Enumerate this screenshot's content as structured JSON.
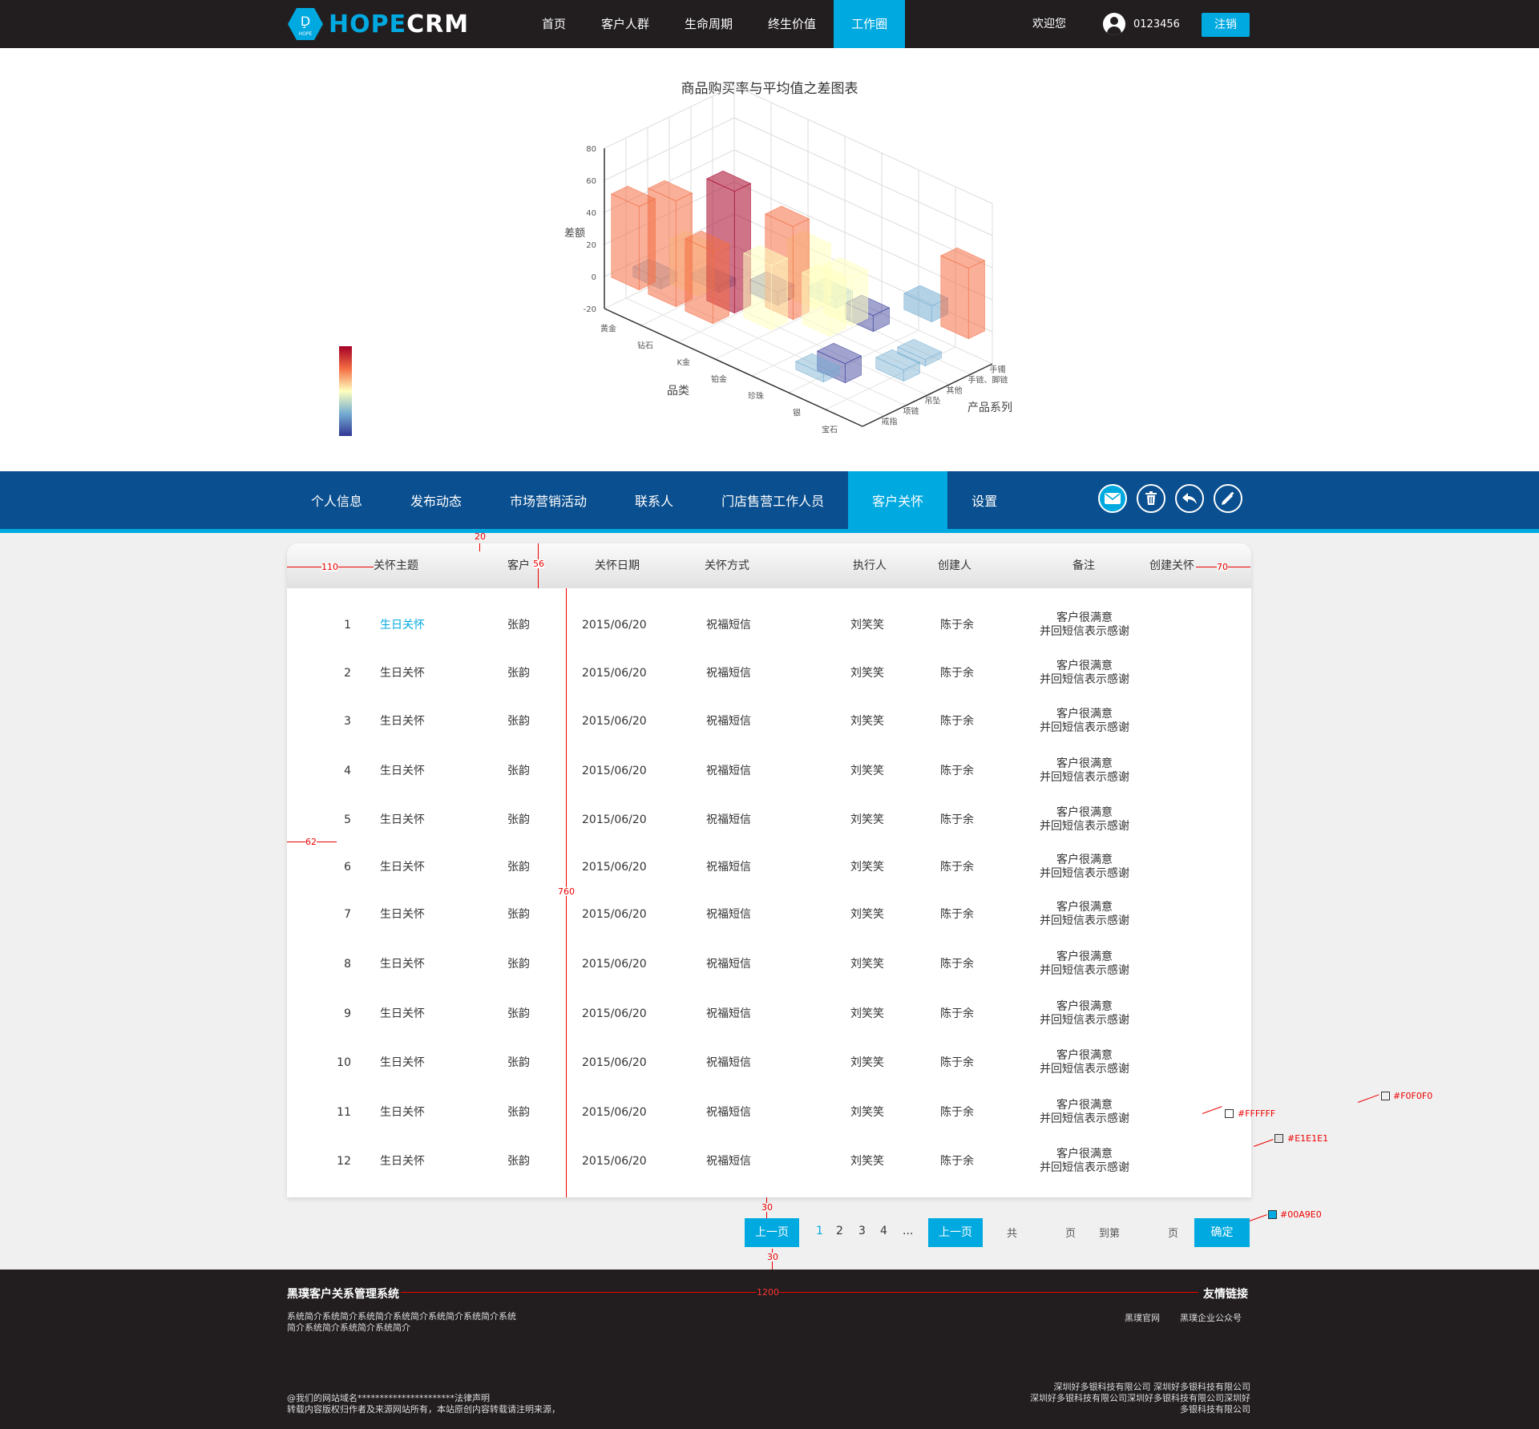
{
  "header": {
    "brand_left": "HOPE",
    "brand_right": "CRM",
    "logo_small_text": "HOPE",
    "nav": [
      "首页",
      "客户人群",
      "生命周期",
      "终生价值",
      "工作圈"
    ],
    "nav_active_index": 4,
    "welcome": "欢迎您",
    "username": "0123456",
    "logout": "注销"
  },
  "chart": {
    "title": "商品购买率与平均值之差图表"
  },
  "chart_data": {
    "type": "bar3d",
    "title": "商品购买率与平均值之差图表",
    "xlabel": "品类",
    "ylabel": "产品系列",
    "zlabel": "差额",
    "x_categories": [
      "黄金",
      "钻石",
      "K金",
      "铂金",
      "珍珠",
      "银",
      "宝石"
    ],
    "y_categories": [
      "手镯",
      "手链、脚链",
      "其他",
      "吊坠",
      "项链",
      "戒指"
    ],
    "z_ticks": [
      -20,
      0,
      20,
      40,
      60,
      80
    ],
    "zlim": [
      -20,
      80
    ],
    "colorscale": [
      "#313695",
      "#74add1",
      "#ffffbf",
      "#f46d43",
      "#a50026"
    ],
    "grid": true,
    "visual_map_placement": "left",
    "values": [
      {
        "x": "黄金",
        "y": "戒指",
        "z": 52
      },
      {
        "x": "钻石",
        "y": "戒指",
        "z": 66
      },
      {
        "x": "钻石",
        "y": "项链",
        "z": 28
      },
      {
        "x": "K金",
        "y": "项链",
        "z": 76
      },
      {
        "x": "K金",
        "y": "戒指",
        "z": 45
      },
      {
        "x": "铂金",
        "y": "吊坠",
        "z": 58
      },
      {
        "x": "铂金",
        "y": "项链",
        "z": 40
      },
      {
        "x": "铂金",
        "y": "其他",
        "z": 36
      },
      {
        "x": "珍珠",
        "y": "吊坠",
        "z": 32
      },
      {
        "x": "珍珠",
        "y": "其他",
        "z": 30
      },
      {
        "x": "银",
        "y": "手镯",
        "z": 10
      },
      {
        "x": "宝石",
        "y": "手镯",
        "z": 44
      },
      {
        "x": "黄金",
        "y": "项链",
        "z": -6
      },
      {
        "x": "钻石",
        "y": "吊坠",
        "z": -4
      },
      {
        "x": "K金",
        "y": "其他",
        "z": -8
      },
      {
        "x": "铂金",
        "y": "手链、脚链",
        "z": -6
      },
      {
        "x": "珍珠",
        "y": "手链、脚链",
        "z": -10
      },
      {
        "x": "银",
        "y": "戒指",
        "z": -5
      },
      {
        "x": "银",
        "y": "项链",
        "z": -12
      },
      {
        "x": "宝石",
        "y": "其他",
        "z": -4
      },
      {
        "x": "宝石",
        "y": "吊坠",
        "z": -7
      }
    ]
  },
  "subnav": {
    "items": [
      "个人信息",
      "发布动态",
      "市场营销活动",
      "联系人",
      "门店售营工作人员",
      "客户关怀",
      "设置"
    ],
    "active_index": 5,
    "tool_icons": [
      "mail-icon",
      "trash-icon",
      "reply-icon",
      "edit-icon"
    ]
  },
  "table": {
    "columns": [
      "关怀主题",
      "客户",
      "关怀日期",
      "关怀方式",
      "执行人",
      "创建人",
      "备注",
      "创建关怀"
    ],
    "rows": [
      {
        "no": "1",
        "topic": "生日关怀",
        "customer": "张韵",
        "date": "2015/06/20",
        "method": "祝福短信",
        "executor": "刘笑笑",
        "creator": "陈于余",
        "note1": "客户很满意",
        "note2": "并回短信表示感谢"
      },
      {
        "no": "2",
        "topic": "生日关怀",
        "customer": "张韵",
        "date": "2015/06/20",
        "method": "祝福短信",
        "executor": "刘笑笑",
        "creator": "陈于余",
        "note1": "客户很满意",
        "note2": "并回短信表示感谢"
      },
      {
        "no": "3",
        "topic": "生日关怀",
        "customer": "张韵",
        "date": "2015/06/20",
        "method": "祝福短信",
        "executor": "刘笑笑",
        "creator": "陈于余",
        "note1": "客户很满意",
        "note2": "并回短信表示感谢"
      },
      {
        "no": "4",
        "topic": "生日关怀",
        "customer": "张韵",
        "date": "2015/06/20",
        "method": "祝福短信",
        "executor": "刘笑笑",
        "creator": "陈于余",
        "note1": "客户很满意",
        "note2": "并回短信表示感谢"
      },
      {
        "no": "5",
        "topic": "生日关怀",
        "customer": "张韵",
        "date": "2015/06/20",
        "method": "祝福短信",
        "executor": "刘笑笑",
        "creator": "陈于余",
        "note1": "客户很满意",
        "note2": "并回短信表示感谢"
      },
      {
        "no": "6",
        "topic": "生日关怀",
        "customer": "张韵",
        "date": "2015/06/20",
        "method": "祝福短信",
        "executor": "刘笑笑",
        "creator": "陈于余",
        "note1": "客户很满意",
        "note2": "并回短信表示感谢"
      },
      {
        "no": "7",
        "topic": "生日关怀",
        "customer": "张韵",
        "date": "2015/06/20",
        "method": "祝福短信",
        "executor": "刘笑笑",
        "creator": "陈于余",
        "note1": "客户很满意",
        "note2": "并回短信表示感谢"
      },
      {
        "no": "8",
        "topic": "生日关怀",
        "customer": "张韵",
        "date": "2015/06/20",
        "method": "祝福短信",
        "executor": "刘笑笑",
        "creator": "陈于余",
        "note1": "客户很满意",
        "note2": "并回短信表示感谢"
      },
      {
        "no": "9",
        "topic": "生日关怀",
        "customer": "张韵",
        "date": "2015/06/20",
        "method": "祝福短信",
        "executor": "刘笑笑",
        "creator": "陈于余",
        "note1": "客户很满意",
        "note2": "并回短信表示感谢"
      },
      {
        "no": "10",
        "topic": "生日关怀",
        "customer": "张韵",
        "date": "2015/06/20",
        "method": "祝福短信",
        "executor": "刘笑笑",
        "creator": "陈于余",
        "note1": "客户很满意",
        "note2": "并回短信表示感谢"
      },
      {
        "no": "11",
        "topic": "生日关怀",
        "customer": "张韵",
        "date": "2015/06/20",
        "method": "祝福短信",
        "executor": "刘笑笑",
        "creator": "陈于余",
        "note1": "客户很满意",
        "note2": "并回短信表示感谢"
      },
      {
        "no": "12",
        "topic": "生日关怀",
        "customer": "张韵",
        "date": "2015/06/20",
        "method": "祝福短信",
        "executor": "刘笑笑",
        "creator": "陈于余",
        "note1": "客户很满意",
        "note2": "并回短信表示感谢"
      }
    ]
  },
  "annotations": {
    "a110": "110",
    "a70": "70",
    "a20": "20",
    "a56": "56",
    "a760": "760",
    "a62": "62",
    "a30_top": "30",
    "a30_bottom": "30",
    "a1200": "1200",
    "c_white": "#FFFFFF",
    "c_f0": "#F0F0F0",
    "c_e1": "#E1E1E1",
    "c_blue": "#00A9E0"
  },
  "pagination": {
    "prev": "上一页",
    "pages": [
      "1",
      "2",
      "3",
      "4",
      "..."
    ],
    "current": "1",
    "prev2": "上一页",
    "total_prefix": "共",
    "page_suffix": "页",
    "goto": "到第",
    "page_suffix2": "页",
    "confirm": "确定"
  },
  "footer": {
    "title": "黑璞客户关系管理系统",
    "desc1": "系统简介系统简介系统简介系统简介系统简介系统简介系统",
    "desc2": "简介系统简介系统简介系统简介",
    "links_title": "友情链接",
    "link1": "黑璞官网",
    "link2": "黑璞企业公众号",
    "copy1": "@我们的网站域名**********************法律声明",
    "copy2": "转载内容版权归作者及来源网站所有，本站原创内容转载请注明来源，",
    "company1": "深圳好多银科技有限公司 深圳好多银科技有限公司",
    "company2": "深圳好多银科技有限公司深圳好多银科技有限公司深圳好",
    "company3": "多银科技有限公司"
  }
}
